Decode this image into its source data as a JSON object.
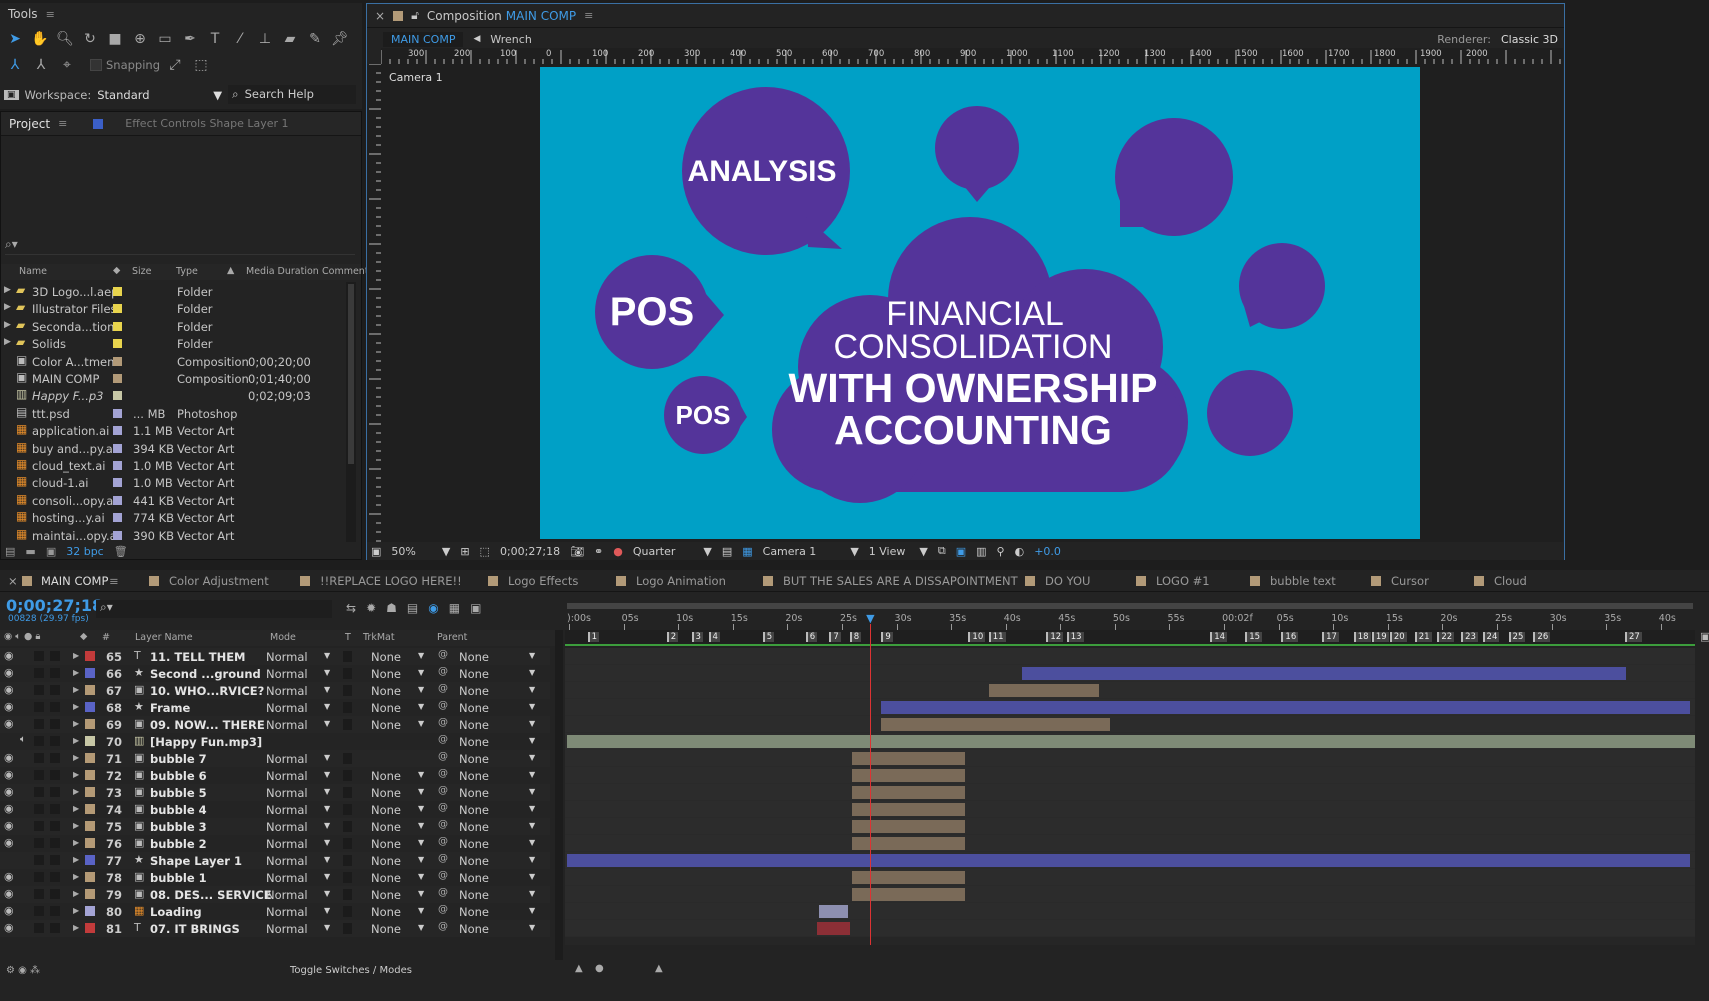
{
  "tools": {
    "title": "Tools",
    "snapping_label": "Snapping",
    "workspace_label": "Workspace:",
    "workspace_value": "Standard",
    "search_help": "Search Help"
  },
  "project": {
    "tab_label": "Project",
    "effect_controls_label": "Effect Controls",
    "effect_controls_target": "Shape Layer 1",
    "columns": {
      "name": "Name",
      "size": "Size",
      "type": "Type",
      "media_duration": "Media Duration",
      "comment": "Comment"
    },
    "items": [
      {
        "name": "3D Logo...l.aep",
        "size": "",
        "type": "Folder",
        "duration": "",
        "icon": "folder",
        "label_color": "#e8d44d",
        "expandable": true
      },
      {
        "name": "Illustrator Files",
        "size": "",
        "type": "Folder",
        "duration": "",
        "icon": "folder",
        "label_color": "#e8d44d",
        "expandable": true
      },
      {
        "name": "Seconda...tions",
        "size": "",
        "type": "Folder",
        "duration": "",
        "icon": "folder",
        "label_color": "#e8d44d",
        "expandable": true
      },
      {
        "name": "Solids",
        "size": "",
        "type": "Folder",
        "duration": "",
        "icon": "folder",
        "label_color": "#e8d44d",
        "expandable": true
      },
      {
        "name": "Color A...tment",
        "size": "",
        "type": "Composition",
        "duration": "0;00;20;00",
        "icon": "composition",
        "label_color": "#b29a78",
        "expandable": false
      },
      {
        "name": "MAIN COMP",
        "size": "",
        "type": "Composition",
        "duration": "0;01;40;00",
        "icon": "composition",
        "label_color": "#b29a78",
        "expandable": false
      },
      {
        "name": "Happy F...p3",
        "size": "",
        "type": "",
        "duration": "0;02;09;03",
        "icon": "audio",
        "label_color": "#c7c7a6",
        "expandable": false
      },
      {
        "name": "ttt.psd",
        "size": "... MB",
        "type": "Photoshop",
        "duration": "",
        "icon": "psd",
        "label_color": "#a3a3d4",
        "expandable": false
      },
      {
        "name": "application.ai",
        "size": "1.1 MB",
        "type": "Vector Art",
        "duration": "",
        "icon": "ai",
        "label_color": "#a3a3d4",
        "expandable": false
      },
      {
        "name": "buy and...py.ai",
        "size": "394 KB",
        "type": "Vector Art",
        "duration": "",
        "icon": "ai",
        "label_color": "#a3a3d4",
        "expandable": false
      },
      {
        "name": "cloud_text.ai",
        "size": "1.0 MB",
        "type": "Vector Art",
        "duration": "",
        "icon": "ai",
        "label_color": "#a3a3d4",
        "expandable": false
      },
      {
        "name": "cloud-1.ai",
        "size": "1.0 MB",
        "type": "Vector Art",
        "duration": "",
        "icon": "ai",
        "label_color": "#a3a3d4",
        "expandable": false
      },
      {
        "name": "consoli...opy.ai",
        "size": "441 KB",
        "type": "Vector Art",
        "duration": "",
        "icon": "ai",
        "label_color": "#a3a3d4",
        "expandable": false
      },
      {
        "name": "hosting...y.ai",
        "size": "774 KB",
        "type": "Vector Art",
        "duration": "",
        "icon": "ai",
        "label_color": "#a3a3d4",
        "expandable": false
      },
      {
        "name": "maintai...opy.ai",
        "size": "390 KB",
        "type": "Vector Art",
        "duration": "",
        "icon": "ai",
        "label_color": "#a3a3d4",
        "expandable": false
      }
    ],
    "bpc": "32 bpc"
  },
  "composition": {
    "tab_prefix": "Composition",
    "tab_name": "MAIN COMP",
    "flow_tab": "MAIN COMP",
    "flow_next": "Wrench",
    "renderer_label": "Renderer:",
    "renderer_value": "Classic 3D",
    "camera_label": "Camera 1",
    "ruler_ticks": [
      "300",
      "200",
      "100",
      "0",
      "100",
      "200",
      "300",
      "400",
      "500",
      "600",
      "700",
      "800",
      "900",
      "1000",
      "1100",
      "1200",
      "1300",
      "1400",
      "1500",
      "1600",
      "1700",
      "1800",
      "1900",
      "2000"
    ],
    "canvas": {
      "bg_color": "#00a0c6",
      "bubble_color": "#54349a",
      "text_color": "#ffffff",
      "analysis": "ANALYSIS",
      "pos_large": "POS",
      "pos_small": "POS",
      "line1": "FINANCIAL",
      "line2": "CONSOLIDATION",
      "line3": "WITH OWNERSHIP",
      "line4": "ACCOUNTING"
    },
    "footer": {
      "zoom": "50%",
      "timecode": "0;00;27;18",
      "resolution": "Quarter",
      "view_camera": "Camera 1",
      "views": "1 View",
      "exposure": "+0.0"
    }
  },
  "timeline": {
    "tabs": [
      "MAIN COMP",
      "Color Adjustment",
      "!!REPLACE LOGO HERE!!",
      "Logo Effects",
      "Logo Animation",
      "BUT THE SALES ARE A DISSAPOINTMENT",
      "DO YOU",
      "LOGO #1",
      "bubble text",
      "Cursor",
      "Cloud"
    ],
    "timecode": "0;00;27;18",
    "frame_info": "00828 (29.97 fps)",
    "columns": {
      "layer_name": "Layer Name",
      "mode": "Mode",
      "t": "T",
      "trkmat": "TrkMat",
      "parent": "Parent",
      "num": "#"
    },
    "ruler": [
      "):00s",
      "05s",
      "10s",
      "15s",
      "20s",
      "25s",
      "30s",
      "35s",
      "40s",
      "45s",
      "50s",
      "55s",
      "00:02f",
      "05s",
      "10s",
      "15s",
      "20s",
      "25s",
      "30s",
      "35s",
      "40s"
    ],
    "markers": [
      "1",
      "2",
      "3",
      "4",
      "5",
      "6",
      "7",
      "8",
      "9",
      "10",
      "11",
      "12",
      "13",
      "14",
      "15",
      "16",
      "17",
      "18",
      "19",
      "20",
      "21",
      "22",
      "23",
      "24",
      "25",
      "26",
      "27"
    ],
    "layers": [
      {
        "num": "65",
        "name": "11. TELL THEM",
        "icon": "text",
        "color": "#c23b3b",
        "mode": "Normal",
        "trkmat": "None",
        "parent": "None",
        "eye": true,
        "bar_start": 0.0,
        "bar_end": 0.0,
        "bar_color": "#8c2f36"
      },
      {
        "num": "66",
        "name": "Second ...ground",
        "icon": "shape",
        "color": "#5a63c6",
        "mode": "Normal",
        "trkmat": "None",
        "parent": "None",
        "eye": true,
        "bar_start": 0.404,
        "bar_end": 0.939,
        "bar_color": "#4c4f9e"
      },
      {
        "num": "67",
        "name": "10. WHO...RVICE?",
        "icon": "comp",
        "color": "#b49a76",
        "mode": "Normal",
        "trkmat": "None",
        "parent": "None",
        "eye": true,
        "bar_start": 0.375,
        "bar_end": 0.473,
        "bar_color": "#7a6a58"
      },
      {
        "num": "68",
        "name": "Frame",
        "icon": "shape",
        "color": "#5a63c6",
        "mode": "Normal",
        "trkmat": "None",
        "parent": "None",
        "eye": true,
        "bar_start": 0.28,
        "bar_end": 0.996,
        "bar_color": "#4c4f9e"
      },
      {
        "num": "69",
        "name": "09. NOW... THERE",
        "icon": "comp",
        "color": "#b49a76",
        "mode": "Normal",
        "trkmat": "None",
        "parent": "None",
        "eye": true,
        "bar_start": 0.28,
        "bar_end": 0.482,
        "bar_color": "#7a6a58"
      },
      {
        "num": "70",
        "name": "[Happy Fun.mp3]",
        "icon": "audio",
        "color": "#c7c7a6",
        "mode": "",
        "trkmat": "",
        "parent": "None",
        "eye": false,
        "bar_start": 0.002,
        "bar_end": 1.0,
        "bar_color": "#7e8a76"
      },
      {
        "num": "71",
        "name": "bubble 7",
        "icon": "comp",
        "color": "#b49a76",
        "mode": "Normal",
        "trkmat": "",
        "parent": "None",
        "eye": true,
        "bar_start": 0.254,
        "bar_end": 0.354,
        "bar_color": "#7a6a58"
      },
      {
        "num": "72",
        "name": "bubble 6",
        "icon": "comp",
        "color": "#b49a76",
        "mode": "Normal",
        "trkmat": "None",
        "parent": "None",
        "eye": true,
        "bar_start": 0.254,
        "bar_end": 0.354,
        "bar_color": "#7a6a58"
      },
      {
        "num": "73",
        "name": "bubble 5",
        "icon": "comp",
        "color": "#b49a76",
        "mode": "Normal",
        "trkmat": "None",
        "parent": "None",
        "eye": true,
        "bar_start": 0.254,
        "bar_end": 0.354,
        "bar_color": "#7a6a58"
      },
      {
        "num": "74",
        "name": "bubble 4",
        "icon": "comp",
        "color": "#b49a76",
        "mode": "Normal",
        "trkmat": "None",
        "parent": "None",
        "eye": true,
        "bar_start": 0.254,
        "bar_end": 0.354,
        "bar_color": "#7a6a58"
      },
      {
        "num": "75",
        "name": "bubble 3",
        "icon": "comp",
        "color": "#b49a76",
        "mode": "Normal",
        "trkmat": "None",
        "parent": "None",
        "eye": true,
        "bar_start": 0.254,
        "bar_end": 0.354,
        "bar_color": "#7a6a58"
      },
      {
        "num": "76",
        "name": "bubble 2",
        "icon": "comp",
        "color": "#b49a76",
        "mode": "Normal",
        "trkmat": "None",
        "parent": "None",
        "eye": true,
        "bar_start": 0.254,
        "bar_end": 0.354,
        "bar_color": "#7a6a58"
      },
      {
        "num": "77",
        "name": "Shape Layer 1",
        "icon": "shape",
        "color": "#5a63c6",
        "mode": "Normal",
        "trkmat": "None",
        "parent": "None",
        "eye": false,
        "bar_start": 0.002,
        "bar_end": 0.996,
        "bar_color": "#4c4f9e"
      },
      {
        "num": "78",
        "name": "bubble 1",
        "icon": "comp",
        "color": "#b49a76",
        "mode": "Normal",
        "trkmat": "None",
        "parent": "None",
        "eye": true,
        "bar_start": 0.254,
        "bar_end": 0.354,
        "bar_color": "#7a6a58"
      },
      {
        "num": "79",
        "name": "08. DES... SERVICE",
        "icon": "comp",
        "color": "#b49a76",
        "mode": "Normal",
        "trkmat": "None",
        "parent": "None",
        "eye": true,
        "bar_start": 0.254,
        "bar_end": 0.354,
        "bar_color": "#7a6a58"
      },
      {
        "num": "80",
        "name": "Loading",
        "icon": "ai",
        "color": "#a3a3d4",
        "mode": "Normal",
        "trkmat": "None",
        "parent": "None",
        "eye": true,
        "bar_start": 0.225,
        "bar_end": 0.25,
        "bar_color": "#8d8fb0"
      },
      {
        "num": "81",
        "name": "07. IT BRINGS",
        "icon": "text",
        "color": "#c23b3b",
        "mode": "Normal",
        "trkmat": "None",
        "parent": "None",
        "eye": true,
        "bar_start": 0.223,
        "bar_end": 0.252,
        "bar_color": "#8c2f36"
      }
    ],
    "playhead": 0.27,
    "toggle_label": "Toggle Switches / Modes"
  }
}
